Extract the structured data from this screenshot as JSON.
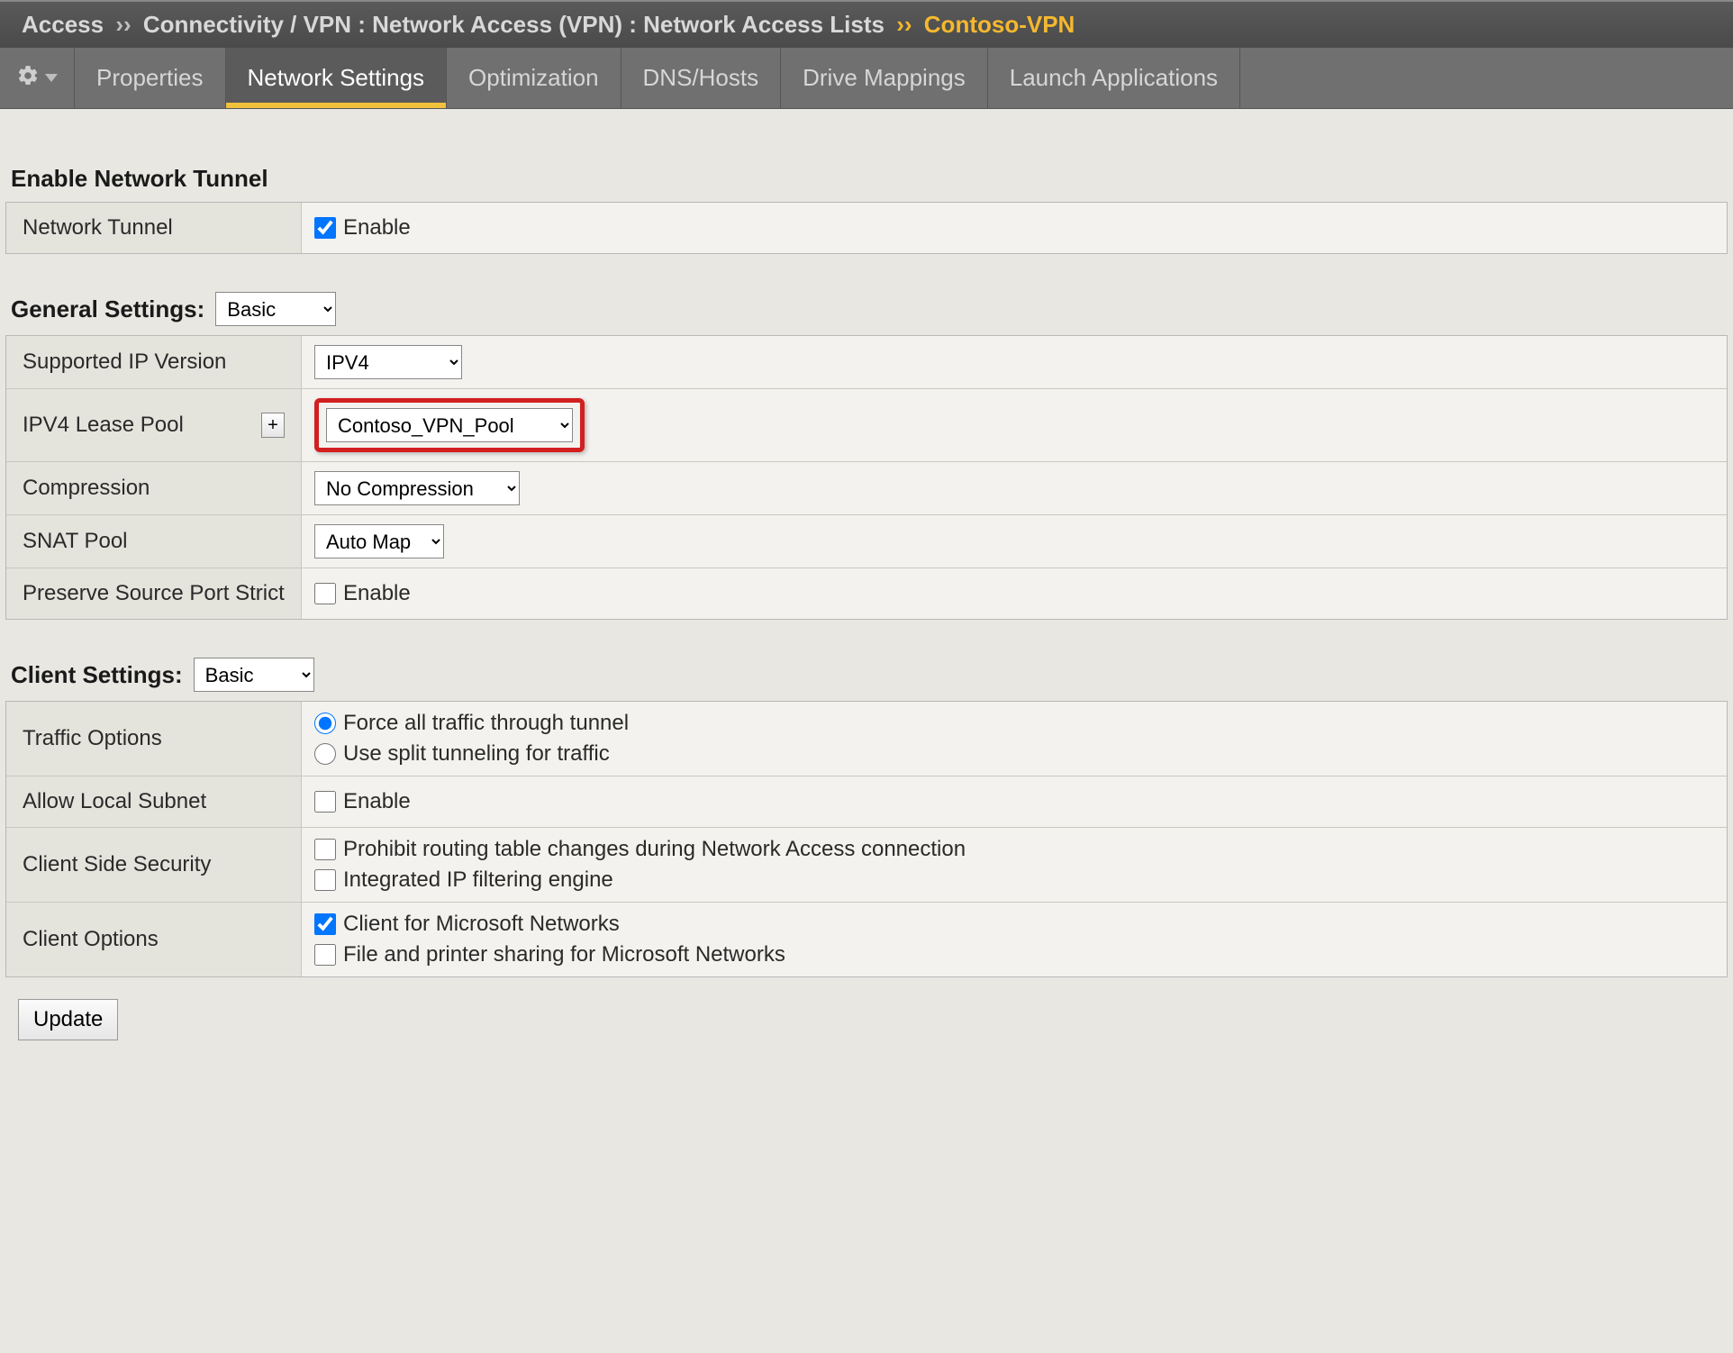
{
  "breadcrumb": {
    "root": "Access",
    "path1": "Connectivity / VPN : Network Access (VPN) : Network Access Lists",
    "leaf": "Contoso-VPN"
  },
  "tabs": [
    {
      "label": "Properties",
      "active": false
    },
    {
      "label": "Network Settings",
      "active": true
    },
    {
      "label": "Optimization",
      "active": false
    },
    {
      "label": "DNS/Hosts",
      "active": false
    },
    {
      "label": "Drive Mappings",
      "active": false
    },
    {
      "label": "Launch Applications",
      "active": false
    }
  ],
  "sections": {
    "enable_tunnel": {
      "title": "Enable Network Tunnel",
      "rows": {
        "network_tunnel": {
          "label": "Network Tunnel",
          "value_label": "Enable",
          "checked": true
        }
      }
    },
    "general": {
      "title": "General Settings:",
      "mode": "Basic",
      "rows": {
        "ip_version": {
          "label": "Supported IP Version",
          "value": "IPV4"
        },
        "lease_pool": {
          "label": "IPV4 Lease Pool",
          "value": "Contoso_VPN_Pool",
          "add_btn": "+"
        },
        "compression": {
          "label": "Compression",
          "value": "No Compression"
        },
        "snat_pool": {
          "label": "SNAT Pool",
          "value": "Auto Map"
        },
        "preserve_port": {
          "label": "Preserve Source Port Strict",
          "value_label": "Enable",
          "checked": false
        }
      }
    },
    "client": {
      "title": "Client Settings:",
      "mode": "Basic",
      "rows": {
        "traffic_options": {
          "label": "Traffic Options",
          "opt_force": "Force all traffic through tunnel",
          "opt_split": "Use split tunneling for traffic",
          "selected": "force"
        },
        "allow_local": {
          "label": "Allow Local Subnet",
          "value_label": "Enable",
          "checked": false
        },
        "client_security": {
          "label": "Client Side Security",
          "opt_prohibit": "Prohibit routing table changes during Network Access connection",
          "opt_ipfilter": "Integrated IP filtering engine",
          "prohibit_checked": false,
          "ipfilter_checked": false
        },
        "client_options": {
          "label": "Client Options",
          "opt_msnet": "Client for Microsoft Networks",
          "opt_fileprint": "File and printer sharing for Microsoft Networks",
          "msnet_checked": true,
          "fileprint_checked": false
        }
      }
    }
  },
  "buttons": {
    "update": "Update"
  }
}
